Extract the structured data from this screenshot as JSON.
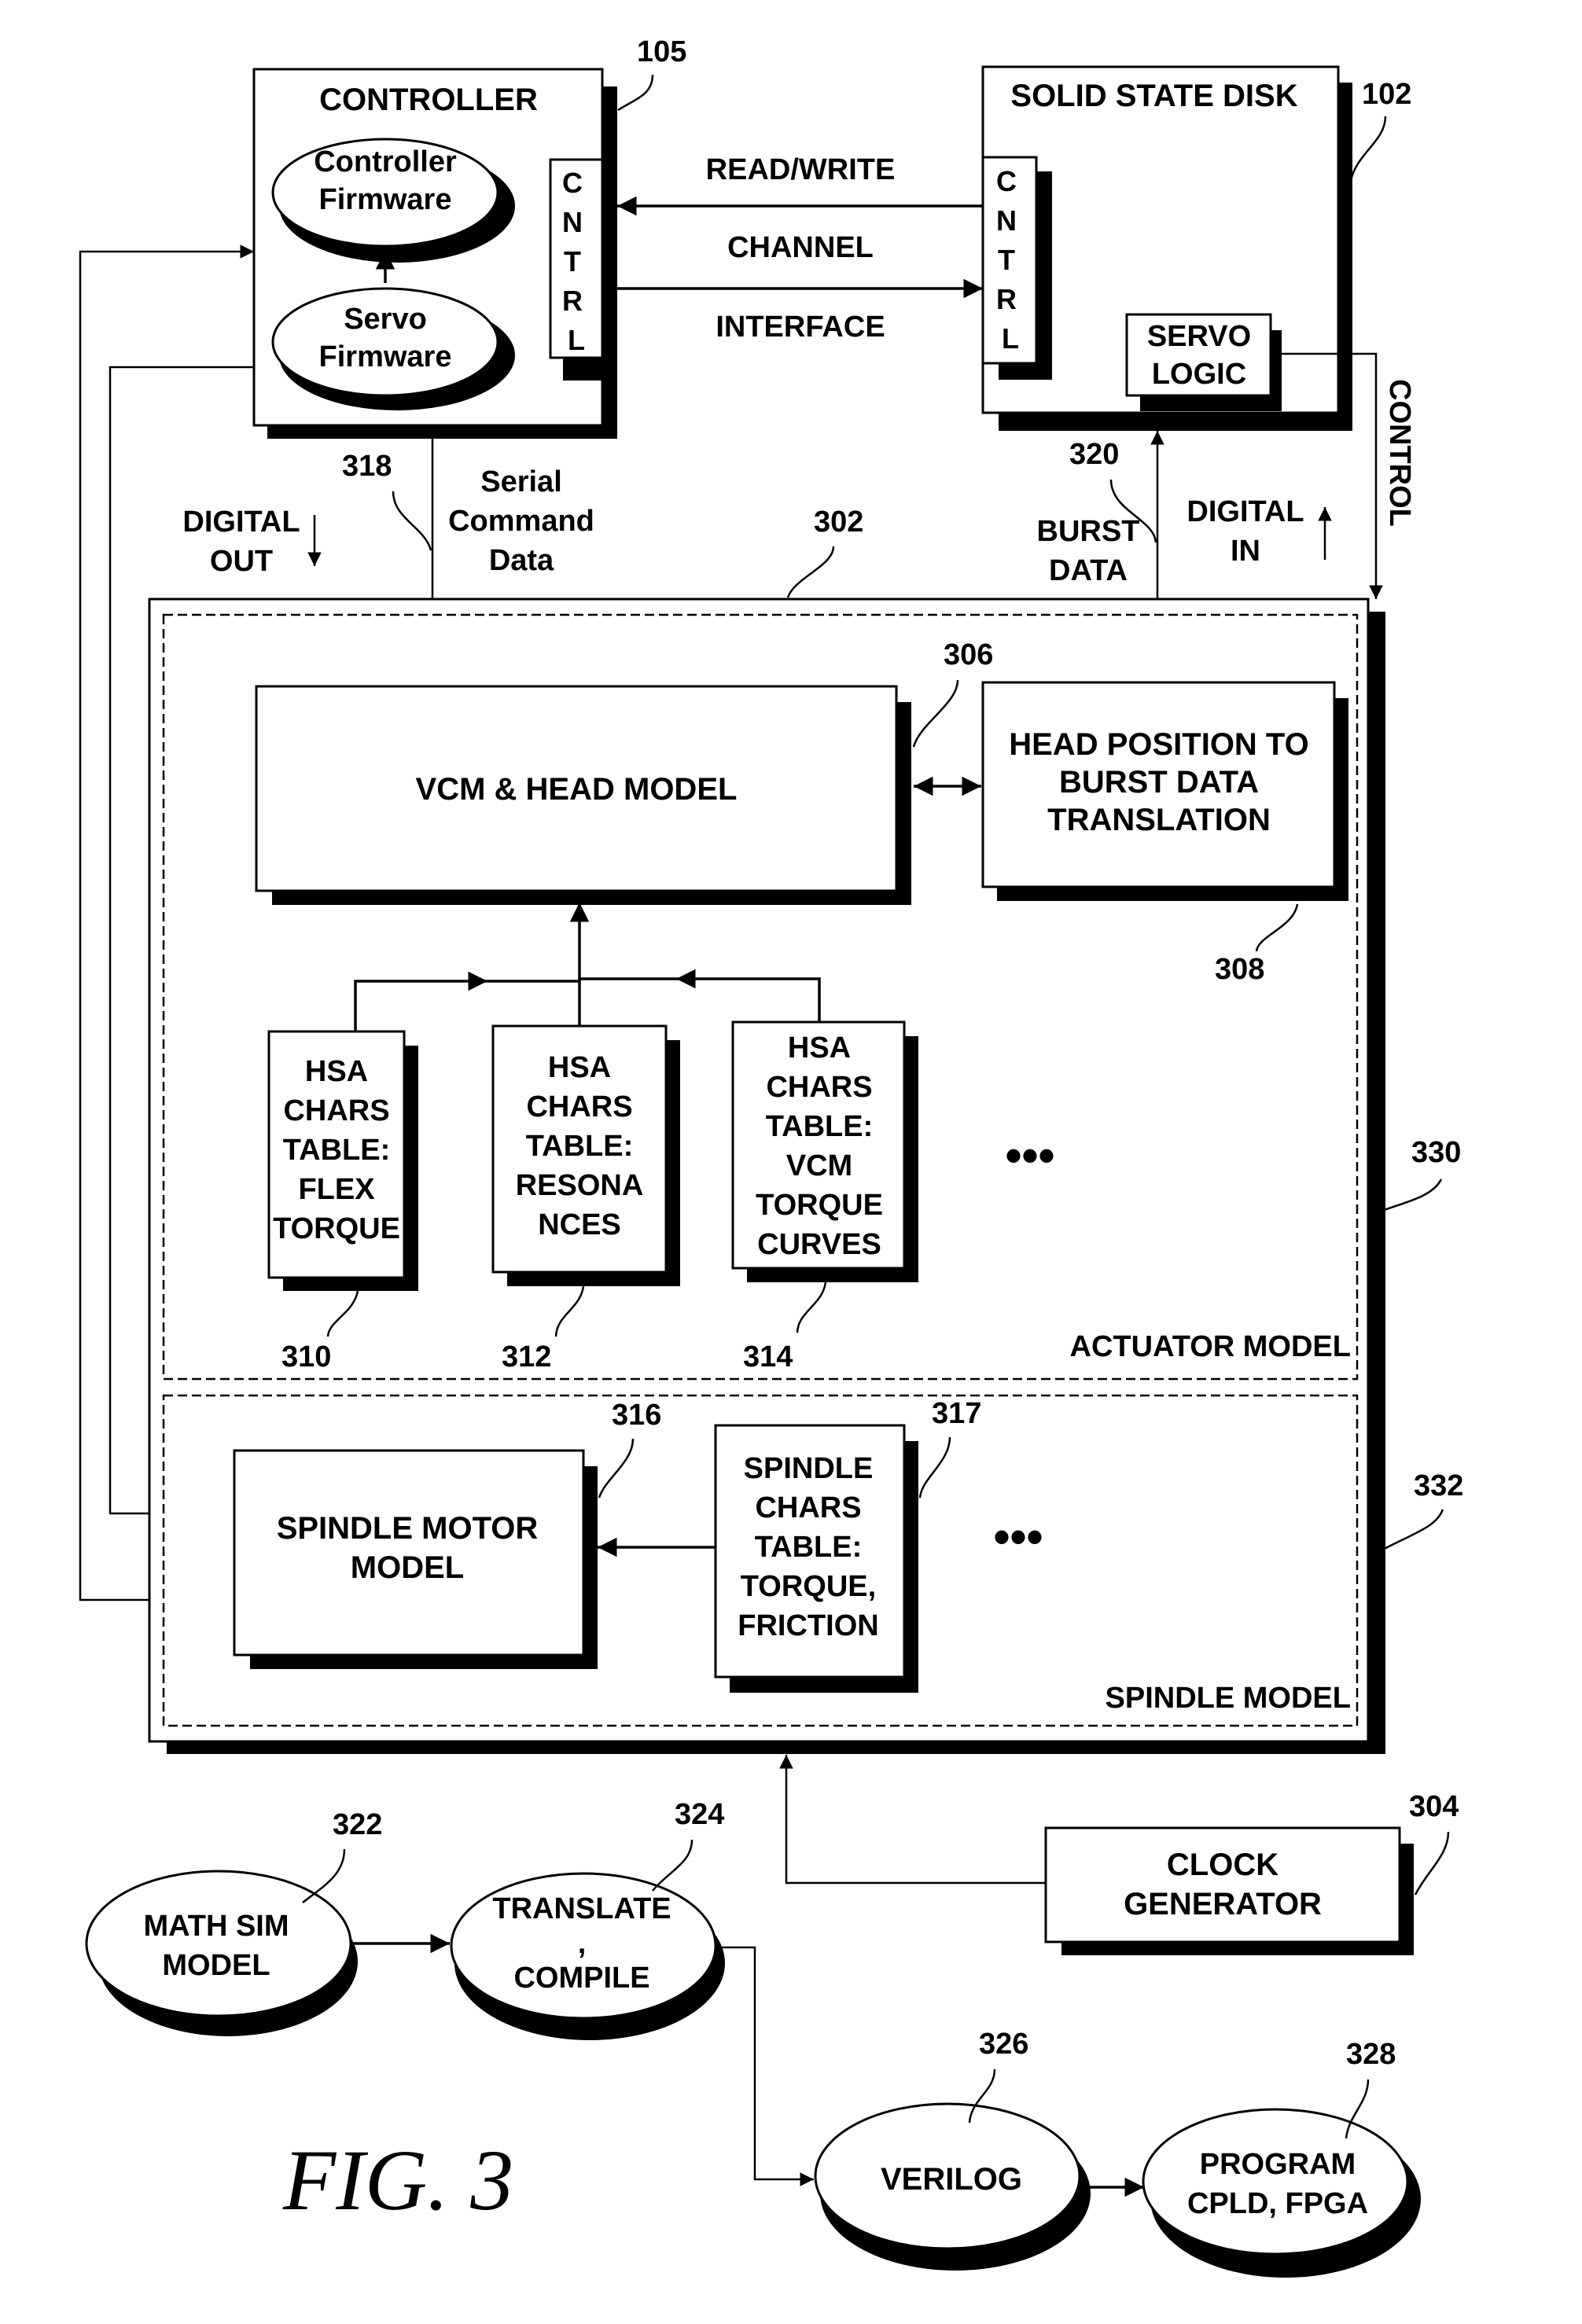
{
  "figure": {
    "title": "FIG. 3"
  },
  "controller": {
    "ref": "105",
    "title": "CONTROLLER",
    "controller_firmware": [
      "Controller",
      "Firmware"
    ],
    "servo_firmware": [
      "Servo",
      "Firmware"
    ],
    "port_letters": [
      "C",
      "N",
      "T",
      "R",
      "L"
    ]
  },
  "ssd": {
    "ref": "102",
    "title": "SOLID STATE DISK",
    "port_letters": [
      "C",
      "N",
      "T",
      "R",
      "L"
    ],
    "servo_logic": [
      "SERVO",
      "LOGIC"
    ]
  },
  "channel": {
    "lines": [
      "READ/WRITE",
      "CHANNEL",
      "INTERFACE"
    ]
  },
  "signals": {
    "control": "CONTROL",
    "digital_out": [
      "DIGITAL",
      "OUT"
    ],
    "serial_command": [
      "Serial",
      "Command",
      "Data"
    ],
    "burst_data": [
      "BURST",
      "DATA"
    ],
    "digital_in": [
      "DIGITAL",
      "IN"
    ],
    "serial_ref": "318",
    "burst_ref": "320"
  },
  "model": {
    "ref": "302",
    "actuator": {
      "ref": "330",
      "label": "ACTUATOR MODEL",
      "vcm": {
        "ref": "306",
        "label": "VCM & HEAD MODEL"
      },
      "head_position": {
        "ref": "308",
        "lines": [
          "HEAD POSITION TO",
          "BURST DATA",
          "TRANSLATION"
        ]
      },
      "tables": [
        {
          "ref": "310",
          "lines": [
            "HSA",
            "CHARS",
            "TABLE:",
            "FLEX",
            "TORQUE"
          ]
        },
        {
          "ref": "312",
          "lines": [
            "HSA",
            "CHARS",
            "TABLE:",
            "RESONA",
            "NCES"
          ]
        },
        {
          "ref": "314",
          "lines": [
            "HSA",
            "CHARS",
            "TABLE:",
            "VCM",
            "TORQUE",
            "CURVES"
          ]
        }
      ],
      "ellipsis": "•••"
    },
    "spindle": {
      "ref": "332",
      "label": "SPINDLE MODEL",
      "motor": {
        "ref": "316",
        "lines": [
          "SPINDLE MOTOR",
          "MODEL"
        ]
      },
      "table": {
        "ref": "317",
        "lines": [
          "SPINDLE",
          "CHARS",
          "TABLE:",
          "TORQUE,",
          "FRICTION"
        ]
      },
      "ellipsis": "•••"
    }
  },
  "clock": {
    "ref": "304",
    "lines": [
      "CLOCK",
      "GENERATOR"
    ]
  },
  "flow": {
    "math_sim": {
      "ref": "322",
      "lines": [
        "MATH SIM",
        "MODEL"
      ]
    },
    "translate": {
      "ref": "324",
      "lines": [
        "TRANSLATE",
        ",",
        "COMPILE"
      ]
    },
    "verilog": {
      "ref": "326",
      "lines": [
        "VERILOG"
      ]
    },
    "program": {
      "ref": "328",
      "lines": [
        "PROGRAM",
        "CPLD, FPGA"
      ]
    }
  }
}
